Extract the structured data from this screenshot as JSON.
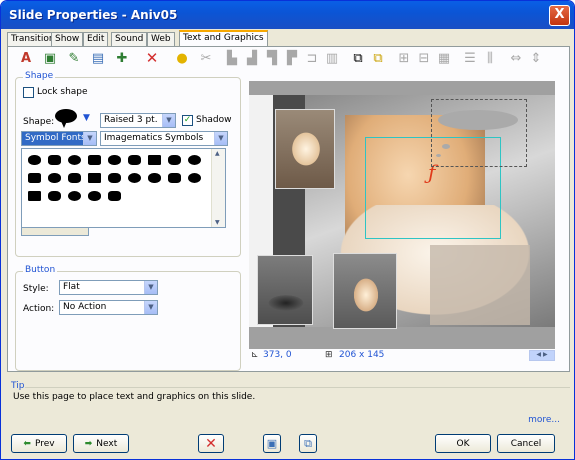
{
  "window": {
    "title": "Slide Properties - Aniv05",
    "close": "X"
  },
  "tabs": [
    {
      "label": "Transition"
    },
    {
      "label": "Show"
    },
    {
      "label": "Edit"
    },
    {
      "label": "Sound"
    },
    {
      "label": "Web"
    },
    {
      "label": "Text and Graphics"
    }
  ],
  "shape_group": {
    "legend": "Shape",
    "lock_shape_label": "Lock shape",
    "shape_label": "Shape:",
    "border_value": "Raised 3 pt.",
    "shadow_label": "Shadow",
    "font_category": "Symbol Fonts",
    "font_name": "Imagematics Symbols"
  },
  "button_group": {
    "legend": "Button",
    "style_label": "Style:",
    "style_value": "Flat",
    "action_label": "Action:",
    "action_value": "No Action"
  },
  "status": {
    "position": "373, 0",
    "size": "206 x 145"
  },
  "tip": {
    "legend": "Tip",
    "text": "Use this page to place text and graphics on this slide.",
    "more": "more..."
  },
  "buttons": {
    "prev": "Prev",
    "next": "Next",
    "ok": "OK",
    "cancel": "Cancel"
  },
  "colors": {
    "titlebar": "#0b55d6",
    "tab_highlight": "#f7a800",
    "accent": "#2154d3",
    "selection": "#316ac5"
  }
}
